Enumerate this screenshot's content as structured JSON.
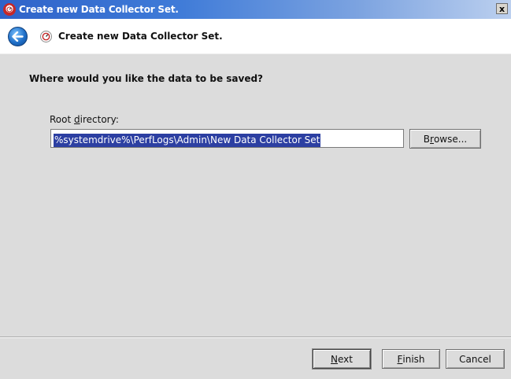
{
  "window": {
    "title": "Create new Data Collector Set.",
    "close_glyph": "x"
  },
  "header": {
    "title": "Create new Data Collector Set.",
    "icon": "performance-monitor-icon"
  },
  "main": {
    "question": "Where would you like the data to be saved?",
    "root_dir_label_before": "Root ",
    "root_dir_label_accel": "d",
    "root_dir_label_after": "irectory:",
    "root_dir_value": "%systemdrive%\\PerfLogs\\Admin\\New Data Collector Set",
    "browse_label_before": "B",
    "browse_label_accel": "r",
    "browse_label_after": "owse..."
  },
  "footer": {
    "next_accel": "N",
    "next_rest": "ext",
    "finish_accel": "F",
    "finish_rest": "inish",
    "cancel_label": "Cancel"
  },
  "colors": {
    "titlebar_start": "#2f63c9",
    "selection": "#2c3fa2",
    "dialog_bg": "#dcdcdc",
    "back_button": "#1f6fc8"
  }
}
